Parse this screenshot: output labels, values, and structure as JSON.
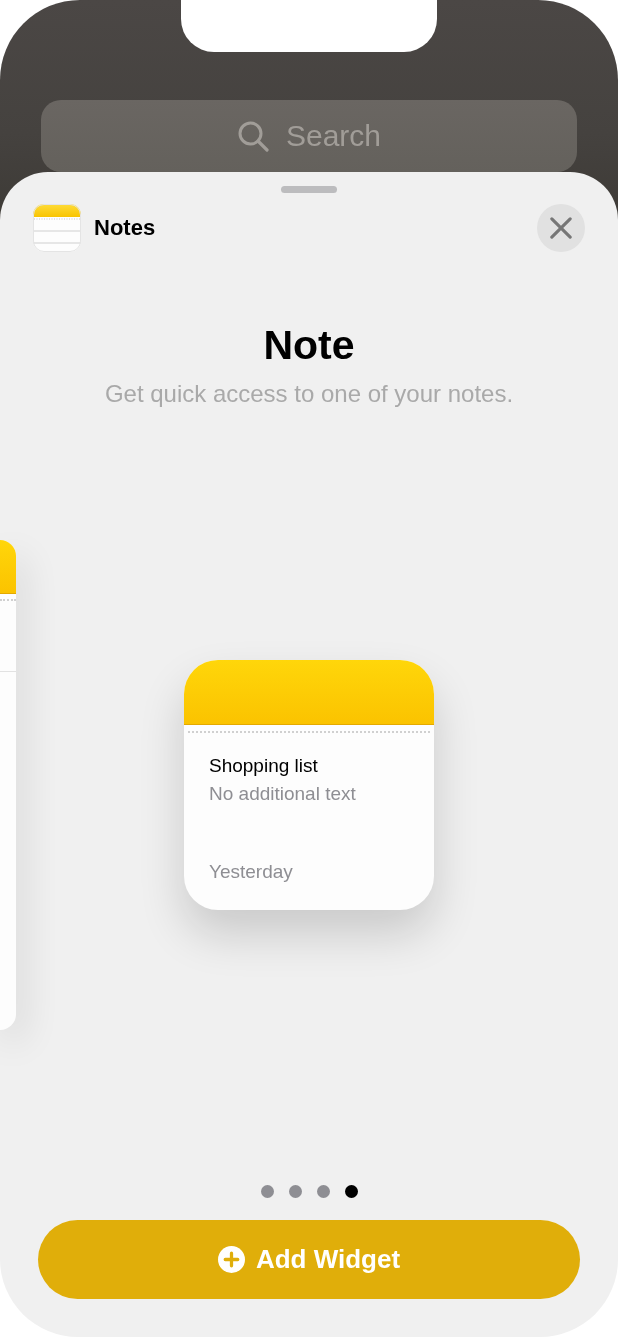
{
  "search": {
    "placeholder": "Search"
  },
  "sheet": {
    "app_name": "Notes",
    "title": "Note",
    "subtitle": "Get quick access to one of your notes."
  },
  "widget_preview": {
    "title": "Shopping list",
    "body": "No additional text",
    "date": "Yesterday"
  },
  "page_dots": [
    {
      "selected": false
    },
    {
      "selected": false
    },
    {
      "selected": false
    },
    {
      "selected": true
    }
  ],
  "add_button": {
    "label": "Add Widget"
  }
}
